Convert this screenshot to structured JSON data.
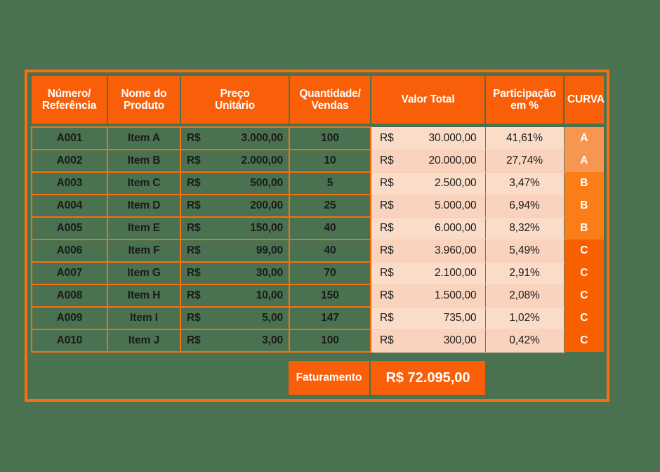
{
  "table": {
    "headers": [
      "Número/\nReferência",
      "Nome do\nProduto",
      "Preço\nUnitário",
      "Quantidade/\nVendas",
      "Valor Total",
      "Participação\nem %",
      "CURVA"
    ],
    "headers_flat": {
      "ref": "Número/ Referência",
      "ref_l1": "Número/",
      "ref_l2": "Referência",
      "name_l1": "Nome do",
      "name_l2": "Produto",
      "price_l1": "Preço",
      "price_l2": "Unitário",
      "qty_l1": "Quantidade/",
      "qty_l2": "Vendas",
      "total": "Valor Total",
      "share_l1": "Participação",
      "share_l2": "em %",
      "curve": "CURVA"
    },
    "currency_symbol": "R$",
    "rows": [
      {
        "ref": "A001",
        "name": "Item A",
        "price_cur": "R$",
        "price": "3.000,00",
        "qty": "100",
        "total_cur": "R$",
        "total": "30.000,00",
        "share": "41,61%",
        "curve": "A"
      },
      {
        "ref": "A002",
        "name": "Item B",
        "price_cur": "R$",
        "price": "2.000,00",
        "qty": "10",
        "total_cur": "R$",
        "total": "20.000,00",
        "share": "27,74%",
        "curve": "A"
      },
      {
        "ref": "A003",
        "name": "Item C",
        "price_cur": "R$",
        "price": "500,00",
        "qty": "5",
        "total_cur": "R$",
        "total": "2.500,00",
        "share": "3,47%",
        "curve": "B"
      },
      {
        "ref": "A004",
        "name": "Item D",
        "price_cur": "R$",
        "price": "200,00",
        "qty": "25",
        "total_cur": "R$",
        "total": "5.000,00",
        "share": "6,94%",
        "curve": "B"
      },
      {
        "ref": "A005",
        "name": "Item E",
        "price_cur": "R$",
        "price": "150,00",
        "qty": "40",
        "total_cur": "R$",
        "total": "6.000,00",
        "share": "8,32%",
        "curve": "B"
      },
      {
        "ref": "A006",
        "name": "Item F",
        "price_cur": "R$",
        "price": "99,00",
        "qty": "40",
        "total_cur": "R$",
        "total": "3.960,00",
        "share": "5,49%",
        "curve": "C"
      },
      {
        "ref": "A007",
        "name": "Item G",
        "price_cur": "R$",
        "price": "30,00",
        "qty": "70",
        "total_cur": "R$",
        "total": "2.100,00",
        "share": "2,91%",
        "curve": "C"
      },
      {
        "ref": "A008",
        "name": "Item H",
        "price_cur": "R$",
        "price": "10,00",
        "qty": "150",
        "total_cur": "R$",
        "total": "1.500,00",
        "share": "2,08%",
        "curve": "C"
      },
      {
        "ref": "A009",
        "name": "Item I",
        "price_cur": "R$",
        "price": "5,00",
        "qty": "147",
        "total_cur": "R$",
        "total": "735,00",
        "share": "1,02%",
        "curve": "C"
      },
      {
        "ref": "A010",
        "name": "Item J",
        "price_cur": "R$",
        "price": "3,00",
        "qty": "100",
        "total_cur": "R$",
        "total": "300,00",
        "share": "0,42%",
        "curve": "C"
      }
    ]
  },
  "footer": {
    "label": "Faturamento",
    "value": "R$ 72.095,00"
  },
  "colors": {
    "page_background": "#4a7150",
    "frame": "#f96f10",
    "header_background": "#f95f08",
    "header_text": "#ffffff",
    "grid_border": "#f96f10",
    "cell_text": "#1b1b1b",
    "peach_row": "#fadcc8",
    "peach_row_alt": "#f9d3bd",
    "curve_a": "#f79650",
    "curve_b": "#fa7d18",
    "curve_c": "#f75f00"
  }
}
